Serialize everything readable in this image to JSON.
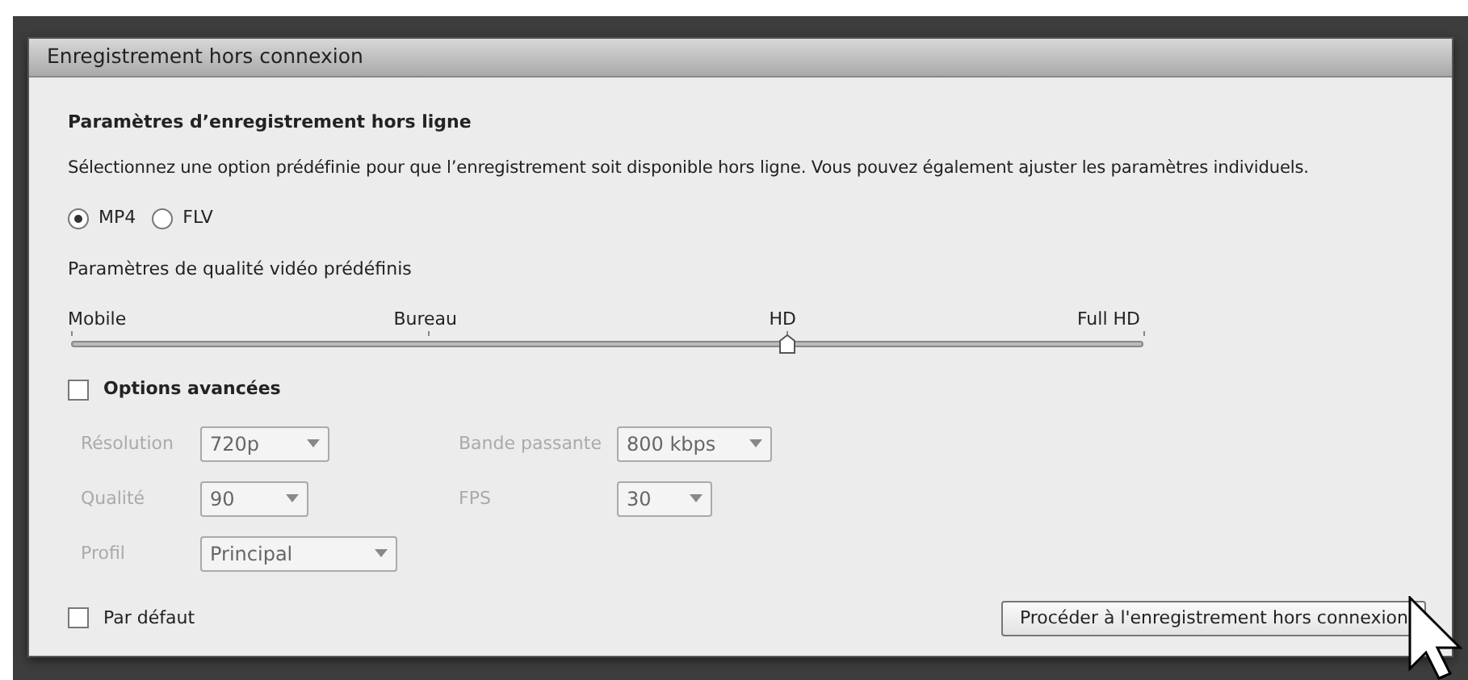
{
  "window": {
    "title": "Enregistrement hors connexion"
  },
  "section_title": "Paramètres d’enregistrement hors ligne",
  "description": "Sélectionnez une option prédéfinie pour que l’enregistrement soit disponible hors ligne. Vous pouvez également ajuster les paramètres individuels.",
  "formats": [
    {
      "label": "MP4",
      "selected": true
    },
    {
      "label": "FLV",
      "selected": false
    }
  ],
  "quality_preset": {
    "label": "Paramètres de qualité vidéo prédéfinis",
    "stops": [
      "Mobile",
      "Bureau",
      "HD",
      "Full HD"
    ],
    "level": 0.667
  },
  "advanced": {
    "label": "Options avancées",
    "checked": false,
    "disabled": true,
    "fields": [
      [
        {
          "label": "Résolution",
          "value": "720p"
        },
        {
          "label": "Bande passante",
          "value": "800 kbps"
        }
      ],
      [
        {
          "label": "Qualité",
          "value": "90"
        },
        {
          "label": "FPS",
          "value": "30"
        }
      ],
      [
        {
          "label": "Profil",
          "value": "Principal"
        }
      ]
    ]
  },
  "default": {
    "label": "Par défaut",
    "checked": false
  },
  "button": "Procéder à l'enregistrement hors connexion"
}
